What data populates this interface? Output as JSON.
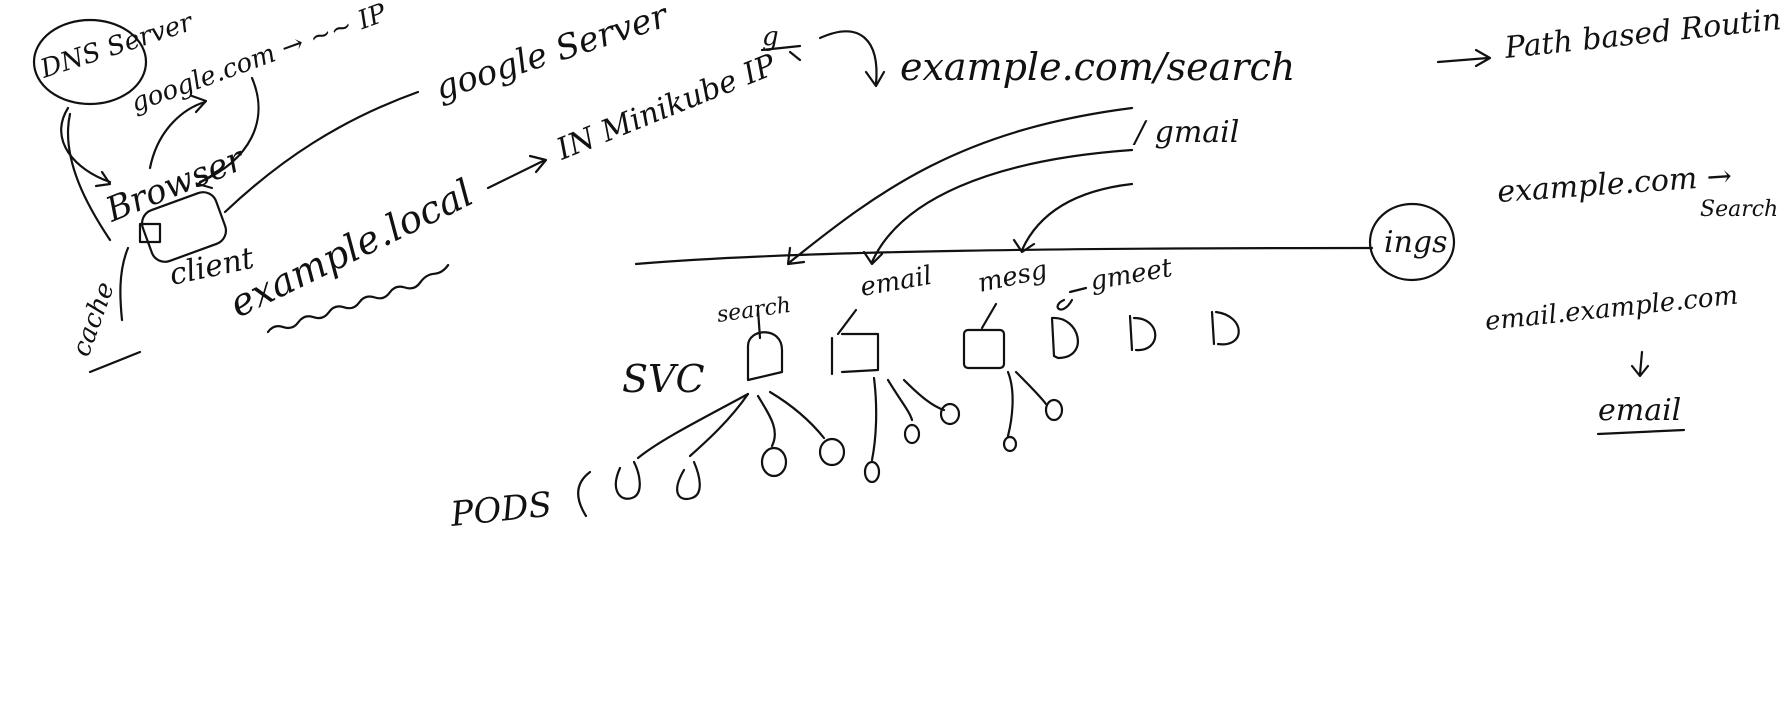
{
  "labels": {
    "dns_server": "DNS Server",
    "google_com": "google.com → ~~ IP",
    "browser": "Browser",
    "google_server": "google Server",
    "client": "client",
    "cache": "cache",
    "example_local": "example.local",
    "in_minikube_ip": "IN Minikube IP",
    "example_search": "example.com/search",
    "gmail_path": "/ gmail",
    "path_based_routing": "Path based Routing",
    "example_to_search_1": "example.com →",
    "example_to_search_2": "Search",
    "email_example": "email.example.com",
    "email_under": "email",
    "ingress": "ings",
    "svc": "SVC",
    "pods": "PODS",
    "search": "search",
    "email": "email",
    "mesg": "mesg",
    "gmeet": "gmeet"
  }
}
